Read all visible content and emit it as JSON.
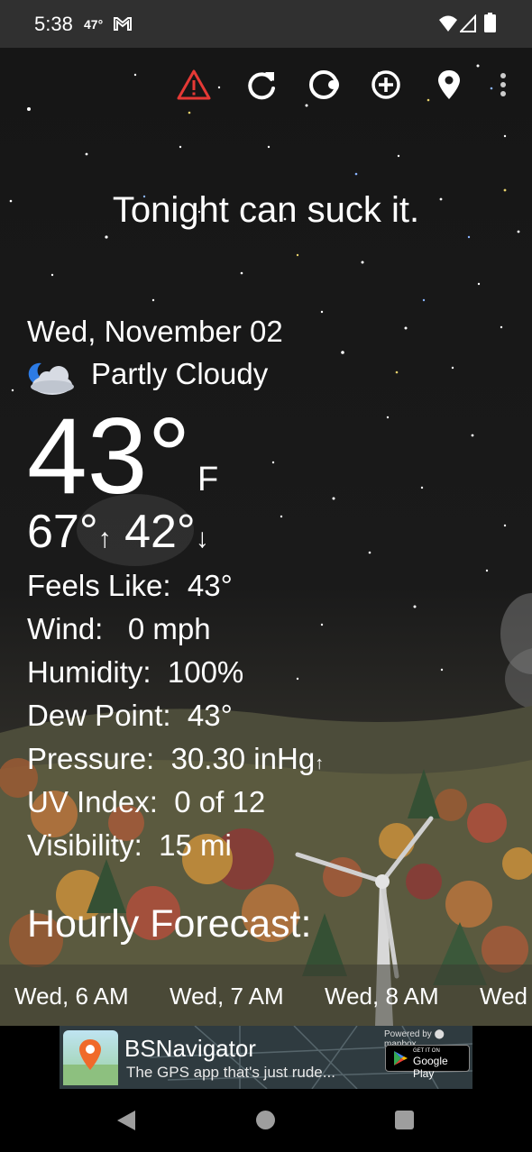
{
  "status_bar": {
    "time": "5:38",
    "temp": "47°",
    "icons": [
      "gmail-icon",
      "wifi-icon",
      "signal-icon",
      "battery-icon"
    ]
  },
  "toolbar": {
    "icons": [
      "alert-icon",
      "refresh-icon",
      "theme-icon",
      "add-location-icon",
      "location-pin-icon",
      "more-options-icon"
    ],
    "alert_color": "#e53935"
  },
  "snark": "Tonight can suck it.",
  "current": {
    "date": "Wed, November 02",
    "condition_icon": "partly-cloudy-night-icon",
    "condition": "Partly Cloudy",
    "temperature": "43°",
    "unit": "F",
    "high": "67°",
    "high_arrow": "↑",
    "low": "42°",
    "low_arrow": "↓"
  },
  "details": [
    {
      "label": "Feels Like:",
      "value": "43°"
    },
    {
      "label": "Wind:",
      "value": " 0 mph"
    },
    {
      "label": "Humidity:",
      "value": "100%"
    },
    {
      "label": "Dew Point:",
      "value": "43°"
    },
    {
      "label": "Pressure:",
      "value": "30.30 inHg",
      "trend": "↑"
    },
    {
      "label": "UV Index:",
      "value": "0 of 12"
    },
    {
      "label": "Visibility:",
      "value": "15 mi"
    }
  ],
  "hourly": {
    "title": "Hourly Forecast:",
    "items": [
      "Wed, 6 AM",
      "Wed, 7 AM",
      "Wed, 8 AM",
      "Wed"
    ]
  },
  "ad": {
    "powered_by": "Powered by ⬤ mapbox",
    "title": "BSNavigator",
    "subtitle": "The GPS app that's just rude...",
    "store_small": "GET IT ON",
    "store_big": "Google Play"
  },
  "nav": {
    "icons": [
      "back-icon",
      "home-icon",
      "recents-icon"
    ]
  }
}
